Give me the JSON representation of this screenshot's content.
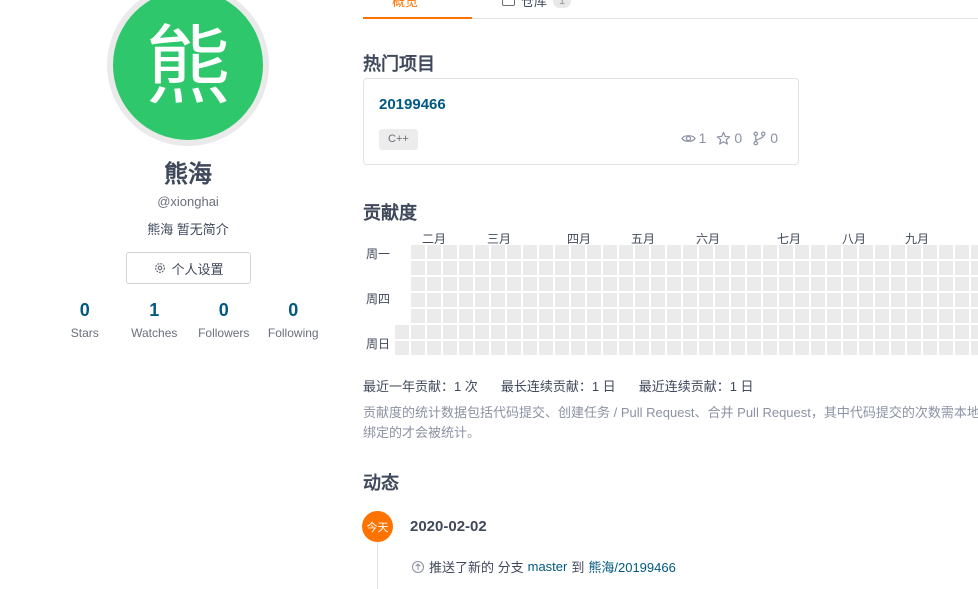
{
  "profile": {
    "avatar_char": "熊",
    "display_name": "熊海",
    "username": "@xionghai",
    "bio": "熊海 暂无简介",
    "settings_label": "个人设置",
    "stats": [
      {
        "value": "0",
        "label": "Stars"
      },
      {
        "value": "1",
        "label": "Watches"
      },
      {
        "value": "0",
        "label": "Followers"
      },
      {
        "value": "0",
        "label": "Following"
      }
    ]
  },
  "tabs": {
    "overview": "概览",
    "repos": "仓库",
    "repos_count": "1"
  },
  "popular": {
    "title": "热门项目",
    "project": {
      "name": "20199466",
      "language": "C++",
      "watchers": "1",
      "stars": "0",
      "forks": "0"
    }
  },
  "contribution": {
    "title": "贡献度",
    "months": [
      "二月",
      "三月",
      "四月",
      "五月",
      "六月",
      "七月",
      "八月",
      "九月"
    ],
    "days": [
      "周一",
      "周四",
      "周日"
    ],
    "total": "最近一年贡献：1 次",
    "longest_streak": "最长连续贡献：1 日",
    "recent_streak": "最近连续贡献：1 日",
    "note": "贡献度的统计数据包括代码提交、创建任务 / Pull Request、合并 Pull Request，其中代码提交的次数需本地配置的 git 邮箱是 Gitee 帐号已确认",
    "note2": "绑定的才会被统计。"
  },
  "activity": {
    "title": "动态",
    "badge": "今天",
    "date": "2020-02-02",
    "prefix": "推送了新的 分支",
    "branch": "master",
    "to": "到",
    "repo": "熊海/20199466"
  },
  "colors": {
    "accent": "#fe7300",
    "link": "#005980",
    "avatar_bg": "#2fc76b",
    "grid_empty": "#ebebeb"
  }
}
